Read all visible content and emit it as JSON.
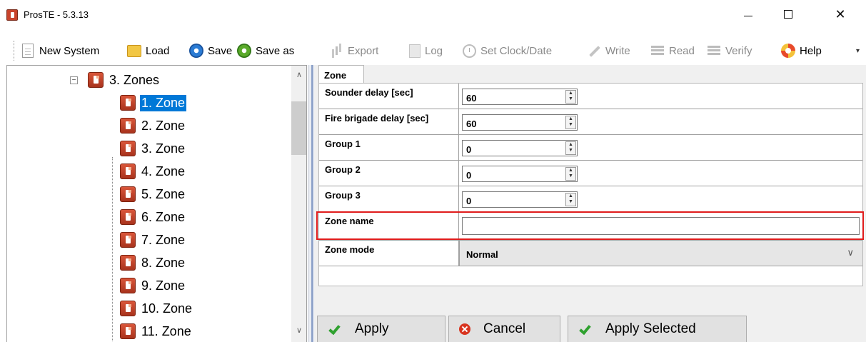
{
  "window": {
    "title": "ProsTE - 5.3.13"
  },
  "toolbar": {
    "new_system": "New System",
    "load": "Load",
    "save": "Save",
    "save_as": "Save as",
    "export": "Export",
    "log": "Log",
    "set_clock": "Set Clock/Date",
    "write": "Write",
    "read": "Read",
    "verify": "Verify",
    "help": "Help"
  },
  "tree": {
    "parent": "3. Zones",
    "items": [
      "1. Zone",
      "2. Zone",
      "3. Zone",
      "4. Zone",
      "5. Zone",
      "6. Zone",
      "7. Zone",
      "8. Zone",
      "9. Zone",
      "10. Zone",
      "11. Zone"
    ],
    "selected_index": 0
  },
  "panel": {
    "tab": "Zone",
    "rows": [
      {
        "label": "Sounder delay [sec]",
        "value": "60"
      },
      {
        "label": "Fire brigade delay [sec]",
        "value": "60"
      },
      {
        "label": "Group 1",
        "value": "0"
      },
      {
        "label": "Group 2",
        "value": "0"
      },
      {
        "label": "Group 3",
        "value": "0"
      }
    ],
    "zone_name_label": "Zone name",
    "zone_name_value": "",
    "zone_mode_label": "Zone mode",
    "zone_mode_value": "Normal"
  },
  "buttons": {
    "apply": "Apply",
    "cancel": "Cancel",
    "apply_selected": "Apply Selected"
  },
  "colors": {
    "selection": "#0078d7",
    "highlight_box": "#e01c1c",
    "node_icon": "#c8432b"
  }
}
